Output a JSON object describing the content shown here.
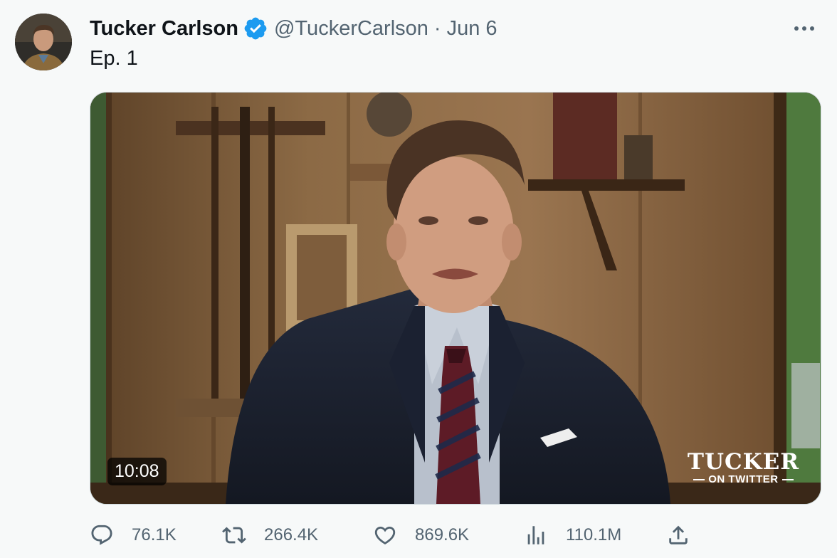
{
  "tweet": {
    "author": {
      "display_name": "Tucker Carlson",
      "handle": "@TuckerCarlson",
      "verified": true,
      "avatar_icon": "avatar-photo"
    },
    "separator": "·",
    "date": "Jun 6",
    "text": "Ep. 1",
    "more_icon": "more-horizontal-icon"
  },
  "media": {
    "type": "video",
    "duration": "10:08",
    "watermark_title": "TUCKER",
    "watermark_subtitle": "ON TWITTER"
  },
  "actions": {
    "reply": {
      "icon": "reply-icon",
      "count": "76.1K"
    },
    "retweet": {
      "icon": "retweet-icon",
      "count": "266.4K"
    },
    "like": {
      "icon": "heart-icon",
      "count": "869.6K"
    },
    "views": {
      "icon": "views-bar-chart-icon",
      "count": "110.1M"
    },
    "share": {
      "icon": "share-icon"
    }
  },
  "colors": {
    "verified_badge": "#1d9bf0",
    "secondary_text": "#536471",
    "primary_text": "#0f1419",
    "background": "#f7f9f9"
  }
}
